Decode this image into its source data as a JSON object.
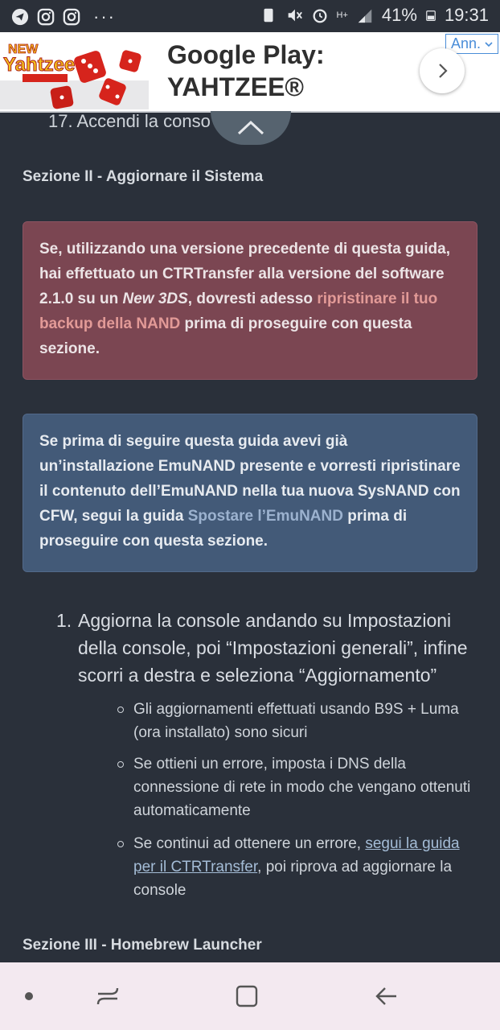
{
  "status_bar": {
    "left_icons": [
      "telegram-icon",
      "instagram-icon",
      "instagram-icon"
    ],
    "more": "···",
    "battery_percent": "41%",
    "time": "19:31",
    "network": "H+"
  },
  "ad": {
    "title": "Google Play:\nYAHTZEE®",
    "ann_label": "Ann.",
    "game_logo_text": "NEW Yahtzee with BUDDIES!"
  },
  "content": {
    "partial_item": "17. Accendi la conso",
    "section2_title": "Sezione II - Aggiornare il Sistema",
    "warning_box": {
      "part1": "Se, utilizzando una versione precedente di questa guida, hai effettuato un CTRTransfer alla versione del software 2.1.0 su un ",
      "italic": "New 3DS",
      "part2": ", dovresti adesso ",
      "link": "ripristinare il tuo backup della NAND",
      "part3": " prima di proseguire con questa sezione."
    },
    "info_box": {
      "part1": "Se prima di seguire questa guida avevi già un’installazione EmuNAND presente e vorresti ripristinare il contenuto dell’EmuNAND nella tua nuova SysNAND con CFW, segui la guida ",
      "link": "Spostare l’EmuNAND",
      "part2": " prima di proseguire con questa sezione."
    },
    "step1": {
      "num": "1.",
      "text": "Aggiorna la console andando su Impostazioni della console, poi “Impostazioni generali”, infine scorri a destra e seleziona “Aggiornamento”"
    },
    "bullets": [
      {
        "text": "Gli aggiornamenti effettuati usando B9S + Luma (ora installato) sono sicuri"
      },
      {
        "text": "Se ottieni un errore, imposta i DNS della connessione di rete in modo che vengano ottenuti automaticamente"
      },
      {
        "pre": "Se continui ad ottenere un errore, ",
        "link": "segui la guida per il CTRTransfer",
        "post": ", poi riprova ad aggiornare la console"
      }
    ],
    "section3_title": "Sezione III - Homebrew Launcher"
  },
  "colors": {
    "background": "#2a303a",
    "warning_bg": "#7b4652",
    "info_bg": "#435a78",
    "nav_bg": "#f3e9f0"
  }
}
